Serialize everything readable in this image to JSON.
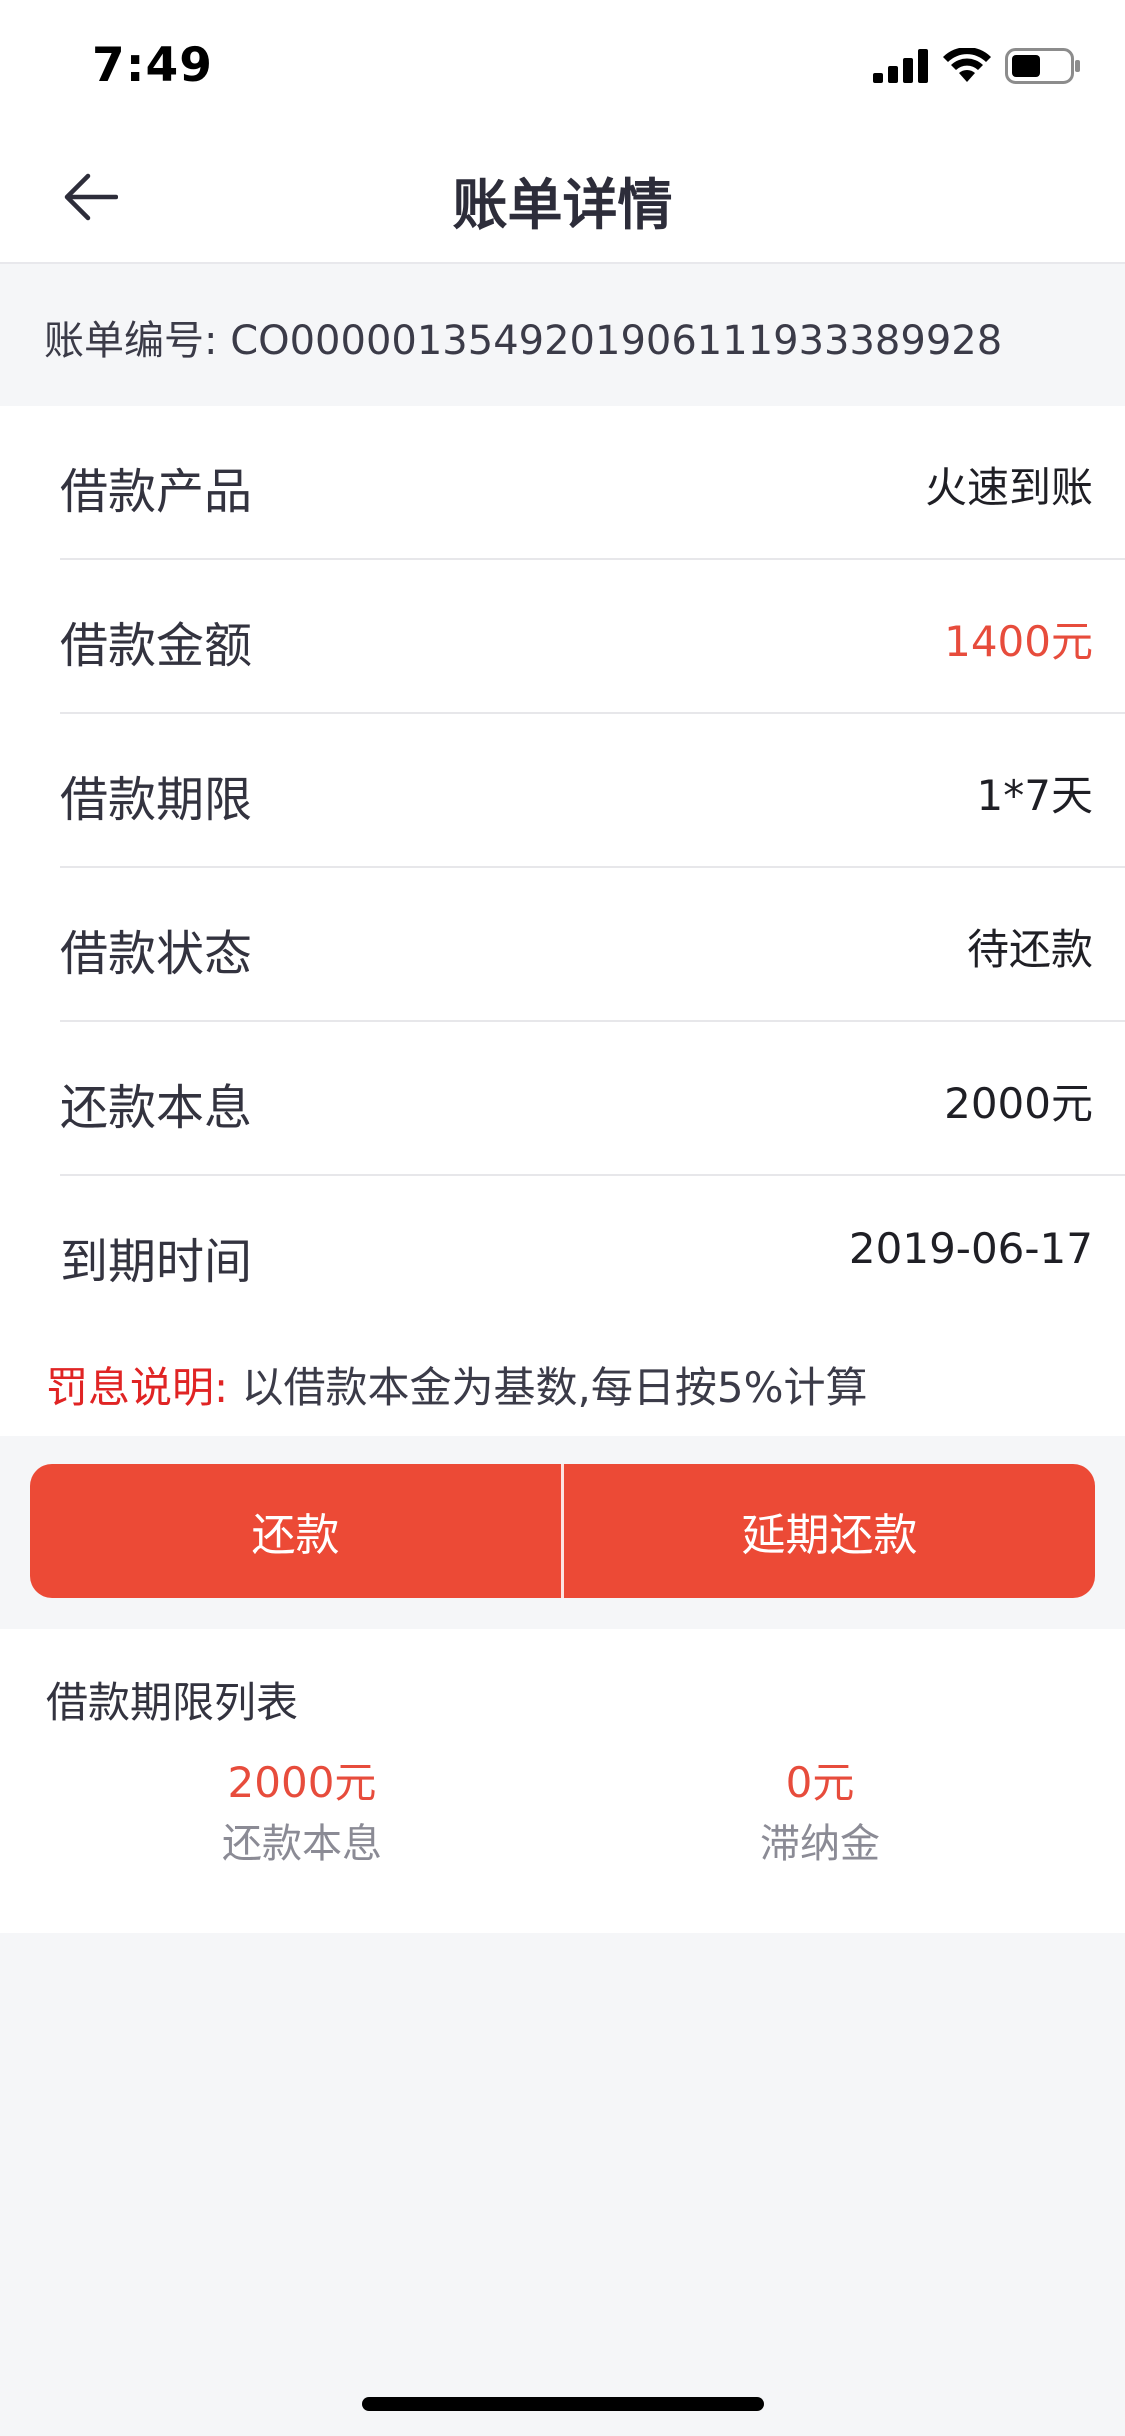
{
  "status_bar": {
    "time": "7:49",
    "icons": [
      "signal-icon",
      "wifi-icon",
      "battery-icon"
    ]
  },
  "header": {
    "title": "账单详情",
    "back_icon": "back-arrow-icon"
  },
  "bill": {
    "number_text": "账单编号: CO00000135492019061119333899 28"
  },
  "details": [
    {
      "label": "借款产品",
      "value": "火速到账"
    },
    {
      "label": "借款金额",
      "value": "1400元"
    },
    {
      "label": "借款期限",
      "value": "1*7天"
    },
    {
      "label": "借款状态",
      "value": "待还款"
    },
    {
      "label": "还款本息",
      "value": "2000元"
    },
    {
      "label": "到期时间",
      "value": "2019-06-17"
    }
  ],
  "penalty": {
    "label": "罚息说明:",
    "desc": " 以借款本金为基数,每日按5%计算"
  },
  "actions": {
    "repay": "还款",
    "extend": "延期还款"
  },
  "term_list": {
    "title": "借款期限列表",
    "principal_value": "2000元",
    "principal_label": "还款本息",
    "late_fee_value": "0元",
    "late_fee_label": "滞纳金"
  },
  "colors": {
    "accent": "#ec4a36",
    "highlight_red": "#e74c3c",
    "penalty_red": "#e02424",
    "background": "#f5f6f8"
  }
}
